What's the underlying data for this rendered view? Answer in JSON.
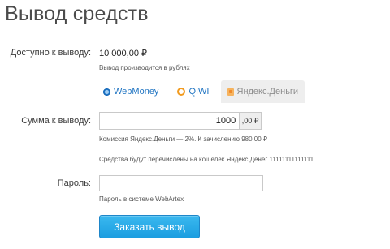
{
  "page": {
    "title": "Вывод средств"
  },
  "available": {
    "label": "Доступно к выводу:",
    "value": "10 000,00 ₽",
    "hint": "Вывод производится в рублях"
  },
  "payment_methods": {
    "tabs": [
      {
        "label": "WebMoney",
        "icon": "webmoney-icon",
        "active": false
      },
      {
        "label": "QIWI",
        "icon": "qiwi-icon",
        "active": false
      },
      {
        "label": "Яндекс.Деньги",
        "icon": "yandex-money-icon",
        "active": true
      }
    ]
  },
  "amount": {
    "label": "Сумма к выводу:",
    "value": "1000",
    "suffix": ",00 ₽",
    "commission_hint": "Комиссия Яндекс.Деньги — 2%. К зачислению 980,00 ₽",
    "transfer_hint": "Средства будут перечислены на кошелёк Яндекс.Денег 11111111111111"
  },
  "password": {
    "label": "Пароль:",
    "value": "",
    "hint": "Пароль в системе WebArtex"
  },
  "submit": {
    "label": "Заказать вывод"
  },
  "colors": {
    "accent": "#1f74c2",
    "button": "#1b9ee0",
    "active_tab_bg": "#eeeeee"
  }
}
